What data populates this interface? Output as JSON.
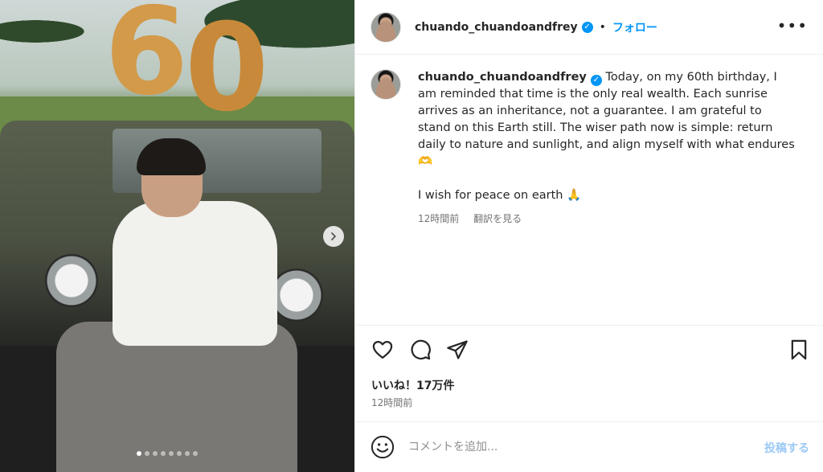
{
  "post": {
    "username": "chuando_chuandoandfrey",
    "follow_label": "フォロー",
    "separator": "•",
    "more_label": "•••",
    "caption_line1": "Today, on my 60th birthday, I am reminded that time is the only real wealth. Each sunrise arrives as an inheritance, not a guarantee. I am grateful to stand on this Earth still. The wiser path now is simple: return daily to nature and sunlight, and align myself with what endures🫶",
    "caption_line2": "I wish for peace on earth 🙏",
    "caption_time": "12時間前",
    "translate_label": "翻訳を見る",
    "likes": "いいね！17万件",
    "post_time": "12時間前",
    "comment_placeholder": "コメントを追加...",
    "post_button": "投稿する",
    "balloons": [
      "6",
      "0"
    ]
  },
  "carousel": {
    "total_slides": 8,
    "active_index": 0
  },
  "colors": {
    "accent": "#0095f6",
    "muted": "#737373",
    "post_disabled": "#9cc9f5"
  },
  "icons": [
    "heart-icon",
    "comment-icon",
    "share-icon",
    "bookmark-icon",
    "emoji-icon",
    "chevron-right-icon",
    "verified-badge-icon",
    "more-options-icon"
  ]
}
